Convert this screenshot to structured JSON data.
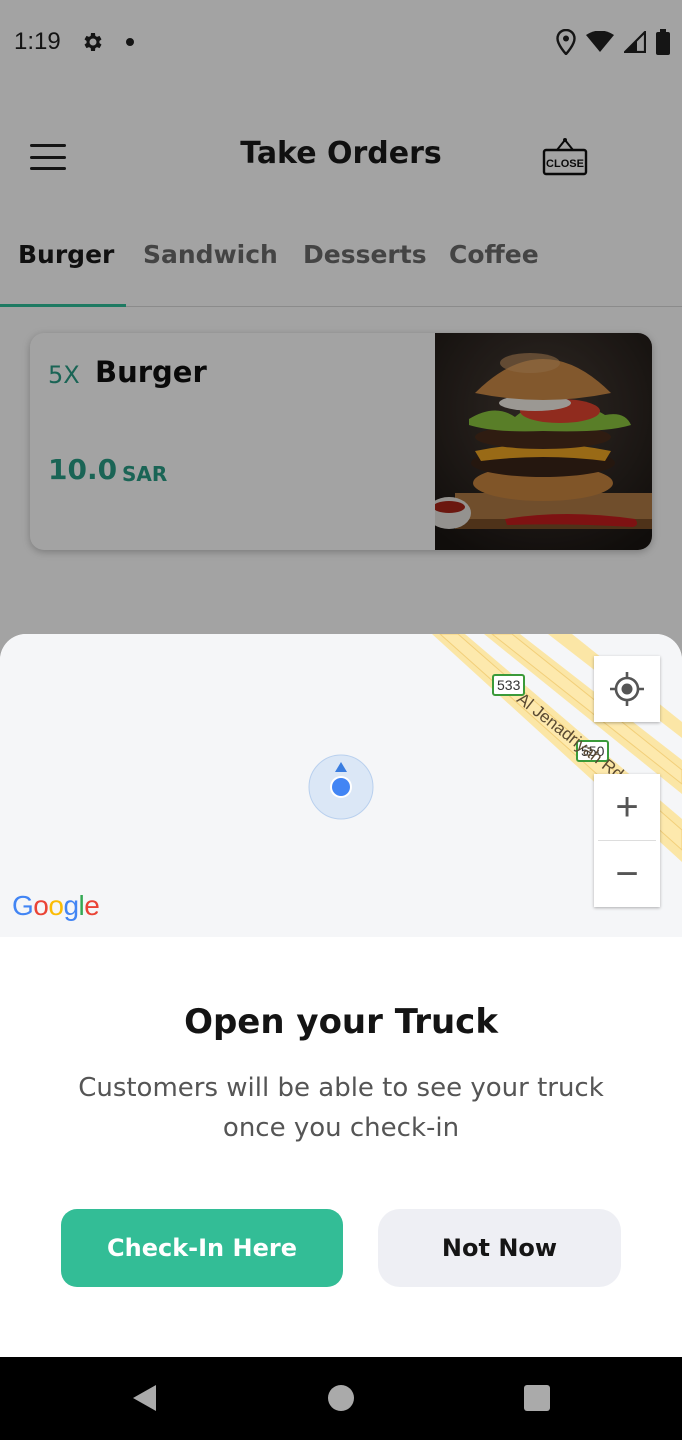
{
  "status_bar": {
    "time": "1:19",
    "icons": [
      "gear-icon",
      "notification-dot",
      "location-icon",
      "wifi-icon",
      "signal-icon",
      "battery-icon"
    ]
  },
  "header": {
    "title": "Take Orders",
    "menu_icon": "hamburger-menu-icon",
    "close_sign_label": "CLOSE"
  },
  "tabs": [
    {
      "label": "Burger",
      "active": true
    },
    {
      "label": "Sandwich",
      "active": false
    },
    {
      "label": "Desserts",
      "active": false
    },
    {
      "label": "Coffee",
      "active": false
    }
  ],
  "product": {
    "quantity": "5X",
    "name": "Burger",
    "price": "10.0",
    "currency": "SAR"
  },
  "map": {
    "road_name": "Al Jenadriyah Rd",
    "shields": [
      "533",
      "550"
    ],
    "zoom_in": "+",
    "zoom_out": "−",
    "attribution": [
      "G",
      "o",
      "o",
      "g",
      "l",
      "e"
    ]
  },
  "sheet": {
    "title": "Open your Truck",
    "description": "Customers will be able to see your truck once you check-in",
    "primary_button": "Check-In Here",
    "secondary_button": "Not Now"
  },
  "colors": {
    "accent": "#33bd96",
    "price": "#2a9d85",
    "secondary_button_bg": "#eeeff4"
  }
}
